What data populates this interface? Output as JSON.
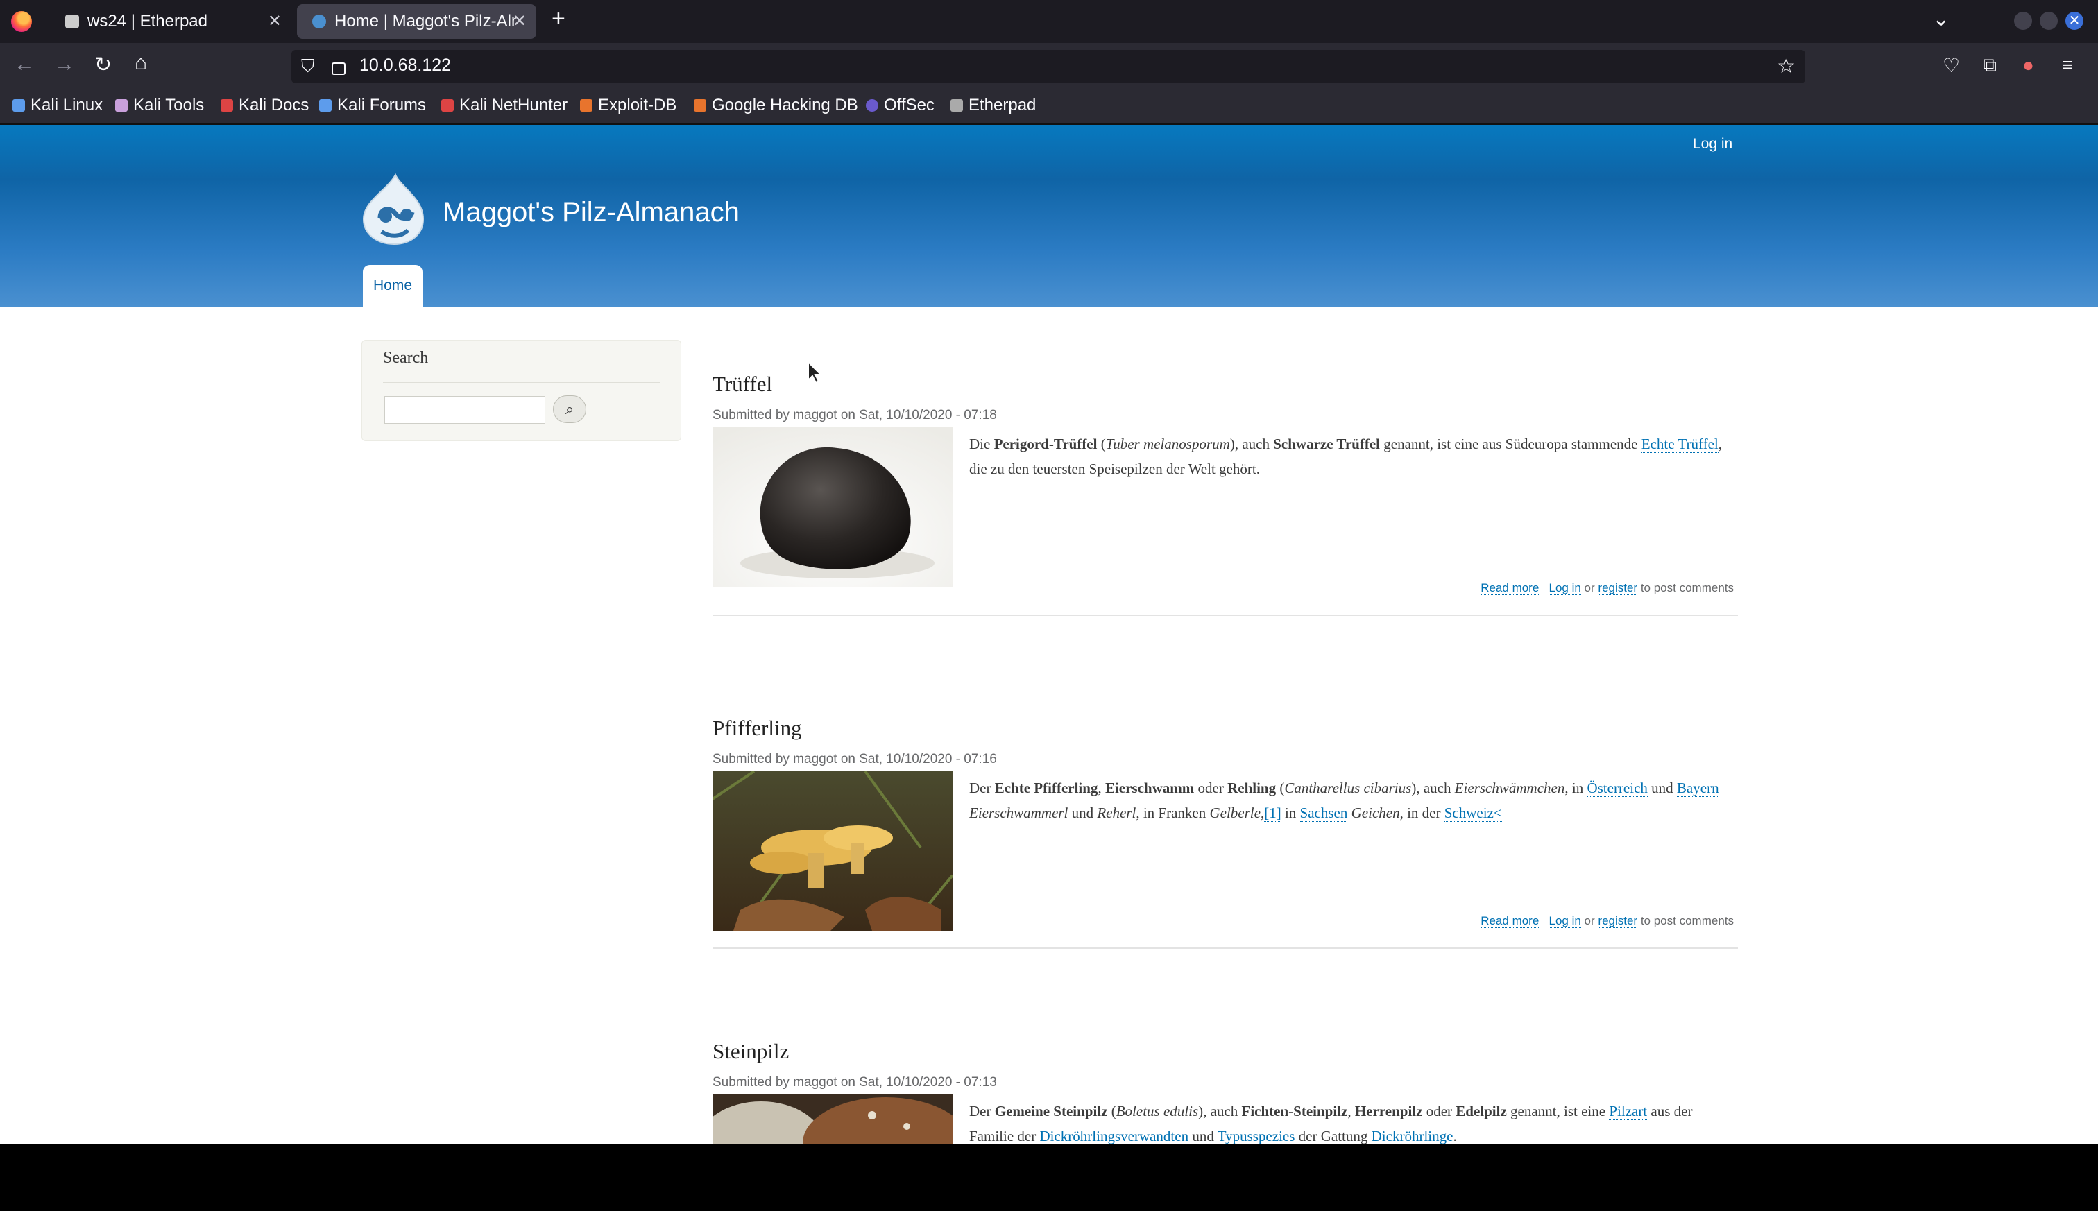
{
  "browser": {
    "tabs": [
      {
        "label": "ws24 | Etherpad",
        "active": false
      },
      {
        "label": "Home | Maggot's Pilz-Alm",
        "active": true
      }
    ],
    "url": "10.0.68.122",
    "bookmarks": [
      "Kali Linux",
      "Kali Tools",
      "Kali Docs",
      "Kali Forums",
      "Kali NetHunter",
      "Exploit-DB",
      "Google Hacking DB",
      "OffSec",
      "Etherpad"
    ]
  },
  "site": {
    "login": "Log in",
    "name": "Maggot's Pilz-Almanach",
    "nav": {
      "home": "Home"
    },
    "colors": {
      "header_top": "#0779bf",
      "header_bottom": "#4a90d0",
      "link": "#0071b3"
    }
  },
  "sidebar": {
    "title": "Search",
    "search_value": ""
  },
  "nodes": [
    {
      "title": "Trüffel",
      "meta": "Submitted by maggot on Sat, 10/10/2020 - 07:18",
      "body": "",
      "read_more": "Read more",
      "login": "Log in",
      "or": "or",
      "register": "register",
      "to_post": "to post comments"
    },
    {
      "title": "Pfifferling",
      "meta": "Submitted by maggot on Sat, 10/10/2020 - 07:16",
      "read_more": "Read more",
      "login": "Log in",
      "or": "or",
      "register": "register",
      "to_post": "to post comments"
    },
    {
      "title": "Steinpilz",
      "meta": "Submitted by maggot on Sat, 10/10/2020 - 07:13"
    }
  ],
  "texts": {
    "t1": [
      "Die ",
      "Perigord-Trüffel",
      " (",
      "Tuber melanosporum",
      "), auch ",
      "Schwarze Trüffel",
      " genannt, ist eine aus Südeuropa stammende ",
      "Echte Trüffel",
      ", die zu den teuersten Speisepilzen der Welt gehört."
    ],
    "t2": [
      "Der ",
      "Echte Pfifferling",
      ", ",
      "Eierschwamm",
      " oder ",
      "Rehling",
      " (",
      "Cantharellus cibarius",
      "), auch ",
      "Eierschwämmchen",
      ", in ",
      "Österreich",
      " und ",
      "Bayern",
      " ",
      "Eierschwammerl",
      " und ",
      "Reherl",
      ", in Franken ",
      "Gelberle",
      ",",
      "[1]",
      " in ",
      "Sachsen",
      " ",
      "Geichen",
      ", in der ",
      "Schweiz<"
    ],
    "t3": [
      "Der ",
      "Gemeine Steinpilz",
      " (",
      "Boletus edulis",
      "), auch ",
      "Fichten-Steinpilz",
      ", ",
      "Herrenpilz",
      " oder ",
      "Edelpilz",
      " genannt, ist eine ",
      "Pilzart",
      " aus der Familie der ",
      "Dickröhrlingsverwandten",
      " und ",
      "Typusspezies",
      " der Gattung ",
      "Dickröhrlinge",
      "."
    ]
  }
}
